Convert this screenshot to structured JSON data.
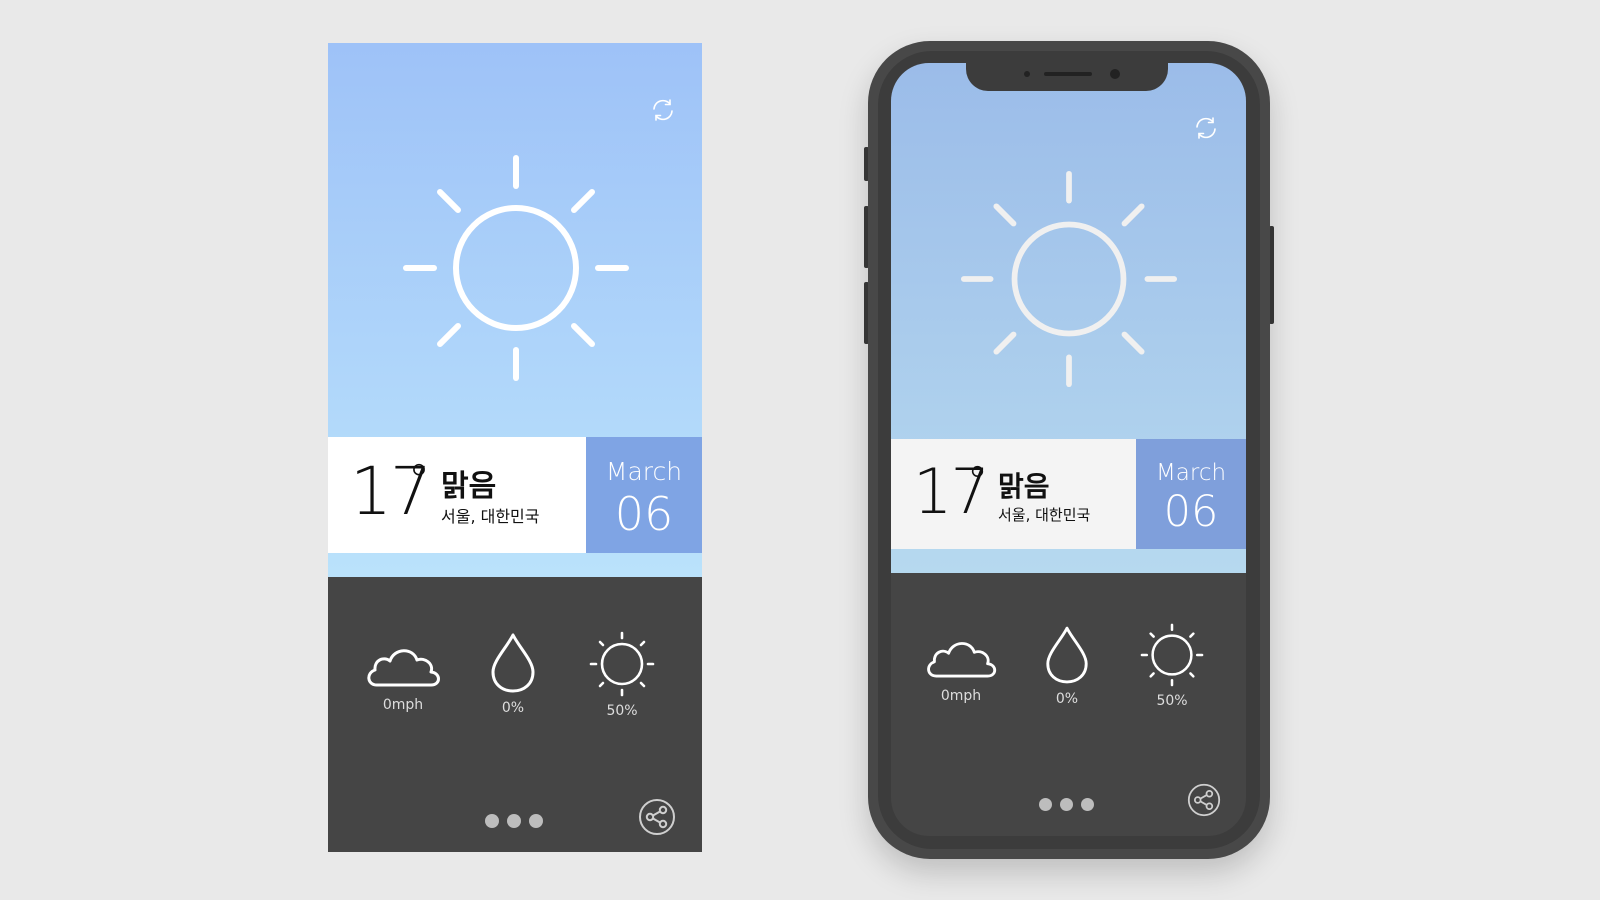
{
  "weather": {
    "temperature": "17",
    "degree_symbol": "°",
    "condition": "맑음",
    "location": "서울, 대한민국",
    "month": "March",
    "day": "06"
  },
  "stats": [
    {
      "icon": "cloud-icon",
      "label": "0mph"
    },
    {
      "icon": "raindrop-icon",
      "label": "0%"
    },
    {
      "icon": "sun-icon",
      "label": "50%"
    }
  ],
  "page_indicator": {
    "count": 3
  },
  "colors": {
    "sky_top": "#9ec2f8",
    "sky_bottom": "#bae2fb",
    "date_box": "#7fa4e4",
    "bottom_panel": "#454545",
    "phone_frame": "#484848"
  }
}
